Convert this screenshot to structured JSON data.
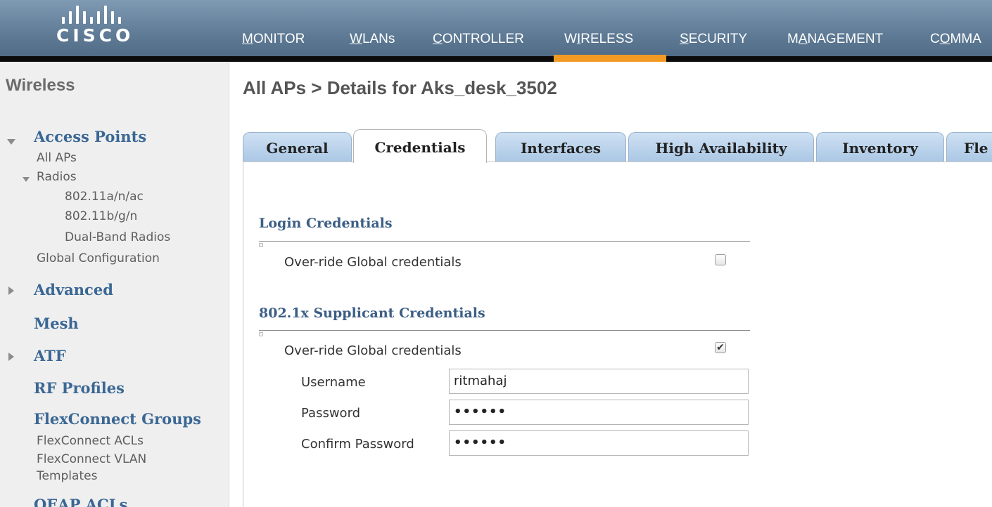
{
  "brand": {
    "name": "CISCO"
  },
  "colors": {
    "accent": "#f29a24",
    "link": "#3a6794",
    "section": "#3c5e85",
    "header": "#5f7b96"
  },
  "nav": {
    "items": [
      {
        "label": "MONITOR",
        "shortcut": "M"
      },
      {
        "label": "WLANs",
        "shortcut": "W"
      },
      {
        "label": "CONTROLLER",
        "shortcut": "C"
      },
      {
        "label": "WIRELESS",
        "shortcut": "I"
      },
      {
        "label": "SECURITY",
        "shortcut": "S"
      },
      {
        "label": "MANAGEMENT",
        "shortcut": "A"
      },
      {
        "label": "COMMA",
        "shortcut": "O"
      }
    ],
    "active": "WIRELESS"
  },
  "sidebar": {
    "title": "Wireless",
    "access_points": "Access Points",
    "all_aps": "All APs",
    "radios": "Radios",
    "radio_a": "802.11a/n/ac",
    "radio_b": "802.11b/g/n",
    "radio_dual": "Dual-Band Radios",
    "global_config": "Global Configuration",
    "advanced": "Advanced",
    "mesh": "Mesh",
    "atf": "ATF",
    "rf_profiles": "RF Profiles",
    "flex_groups": "FlexConnect Groups",
    "flex_acls": "FlexConnect ACLs",
    "flex_vlan_1": "FlexConnect VLAN",
    "flex_vlan_2": "Templates",
    "oeap": "OEAP ACLs"
  },
  "main": {
    "title": "All APs > Details for Aks_desk_3502",
    "tabs": {
      "general": "General",
      "credentials": "Credentials",
      "interfaces": "Interfaces",
      "high_availability": "High Availability",
      "inventory": "Inventory",
      "flex": "Fle"
    },
    "active_tab": "Credentials",
    "login": {
      "title": "Login Credentials",
      "override_label": "Over-ride Global credentials",
      "override_checked": false
    },
    "supplicant": {
      "title": "802.1x Supplicant Credentials",
      "override_label": "Over-ride Global credentials",
      "override_checked": true,
      "check_glyph": "✔",
      "username_label": "Username",
      "username": "ritmahaj",
      "password_label": "Password",
      "password": "••••••",
      "confirm_label": "Confirm Password",
      "confirm": "••••••"
    }
  }
}
